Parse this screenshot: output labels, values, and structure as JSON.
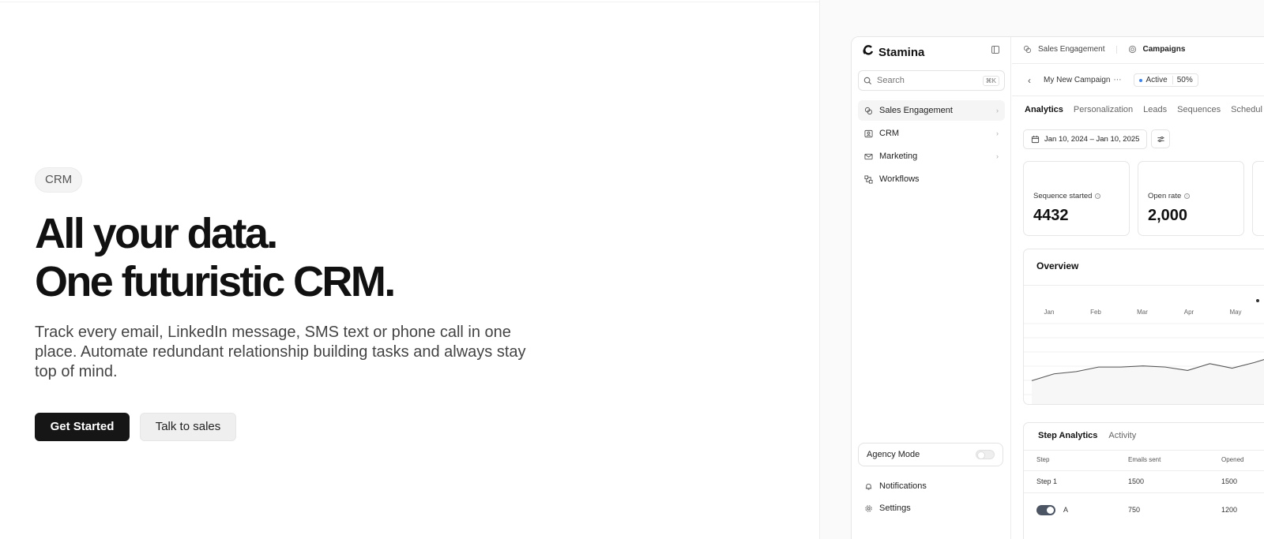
{
  "hero": {
    "badge": "CRM",
    "headline_line1": "All your data.",
    "headline_line2": "One futuristic CRM.",
    "subtext": "Track every email, LinkedIn message, SMS text or phone call in one place. Automate redundant relationship building tasks and always stay top of mind.",
    "primary_button": "Get Started",
    "secondary_button": "Talk to sales"
  },
  "app": {
    "brand": "Stamina",
    "search": {
      "placeholder": "Search",
      "shortcut": "⌘K"
    },
    "nav": [
      {
        "label": "Sales Engagement",
        "icon": "sales-engagement-icon"
      },
      {
        "label": "CRM",
        "icon": "crm-icon"
      },
      {
        "label": "Marketing",
        "icon": "mail-icon"
      },
      {
        "label": "Workflows",
        "icon": "workflows-icon"
      }
    ],
    "agency_mode": {
      "label": "Agency Mode",
      "enabled": false
    },
    "footer_nav": [
      {
        "label": "Notifications",
        "icon": "bell-icon"
      },
      {
        "label": "Settings",
        "icon": "gear-icon"
      }
    ],
    "breadcrumb": {
      "parent": "Sales Engagement",
      "current": "Campaigns"
    },
    "campaign": {
      "name": "My New Campaign",
      "more": "⋯",
      "status": "Active",
      "progress": "50%"
    },
    "tabs": [
      "Analytics",
      "Personalization",
      "Leads",
      "Sequences",
      "Schedul"
    ],
    "date_range": "Jan 10, 2024 – Jan 10, 2025",
    "stats": [
      {
        "label": "Sequence started",
        "value": "4432"
      },
      {
        "label": "Open rate",
        "value": "2,000"
      }
    ],
    "overview": {
      "title": "Overview",
      "months": [
        "Jan",
        "Feb",
        "Mar",
        "Apr",
        "May"
      ]
    },
    "step_analytics": {
      "tabs": [
        "Step Analytics",
        "Activity"
      ],
      "headers": [
        "Step",
        "Emails sent",
        "Opened"
      ],
      "rows": [
        {
          "step": "Step 1",
          "sent": "1500",
          "opened": "1500"
        },
        {
          "step": "A",
          "sent": "750",
          "opened": "1200"
        }
      ]
    }
  },
  "chart_data": {
    "type": "line",
    "title": "Overview",
    "categories": [
      "Jan",
      "Feb",
      "Mar",
      "Apr",
      "May"
    ],
    "series": [
      {
        "values": [
          40,
          46,
          48,
          52,
          52,
          53,
          52,
          49,
          55,
          51,
          56,
          62
        ]
      }
    ],
    "ylim": [
      0,
      100
    ],
    "grid": true
  }
}
